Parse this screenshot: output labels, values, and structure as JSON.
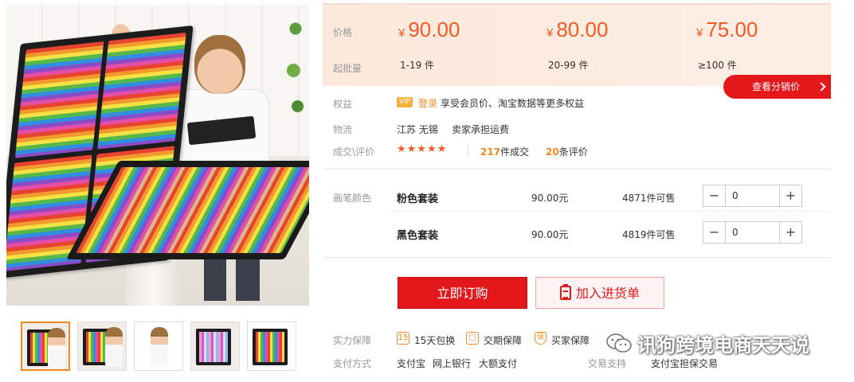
{
  "price_box": {
    "price_label": "价格",
    "moq_label": "起批量",
    "currency": "¥",
    "tiers": [
      {
        "price": "90.00",
        "qty": "1-19 件"
      },
      {
        "price": "80.00",
        "qty": "20-99 件"
      },
      {
        "price": "75.00",
        "qty": "≥100 件"
      }
    ],
    "distributor_button": "查看分销价"
  },
  "info": {
    "benefits_label": "权益",
    "vip_tag": "VIP",
    "login_link": "登录",
    "benefits_text": "享受会员价、淘宝数据等更多权益",
    "logistics_label": "物流",
    "origin": "江苏 无锡",
    "shipping": "卖家承担运费",
    "deals_label": "成交\\评价",
    "stars": "★★★★★",
    "deals_count": "217",
    "deals_suffix": "件成交",
    "reviews_count": "20",
    "reviews_suffix": "条评价"
  },
  "sku": {
    "label": "画笔颜色",
    "items": [
      {
        "name": "粉色套装",
        "price": "90.00元",
        "stock": "4871件可售",
        "quantity": "0"
      },
      {
        "name": "黑色套装",
        "price": "90.00元",
        "stock": "4819件可售",
        "quantity": "0"
      }
    ],
    "minus": "−",
    "plus": "+"
  },
  "actions": {
    "buy_now": "立即订购",
    "add_to_list": "加入进货单"
  },
  "guarantee": {
    "label": "实力保障",
    "items": [
      {
        "icon": "15-day-return-icon",
        "glyph": "15",
        "text": "15天包换"
      },
      {
        "icon": "delivery-guarantee-icon",
        "glyph": "▢",
        "text": "交期保障"
      },
      {
        "icon": "buyer-protection-icon",
        "glyph": "保",
        "text": "买家保障"
      }
    ]
  },
  "payment": {
    "label": "支付方式",
    "methods": [
      "支付宝",
      "网上银行",
      "大额支付"
    ],
    "trade_label": "交易支持",
    "trade_value": "支付宝担保交易"
  },
  "watermark": "讯狗跨境电商天天说",
  "colors": {
    "accent_red": "#e4171b",
    "price_orange": "#f15a22",
    "label_grey": "#999999",
    "price_bg": "#fde9dc"
  }
}
